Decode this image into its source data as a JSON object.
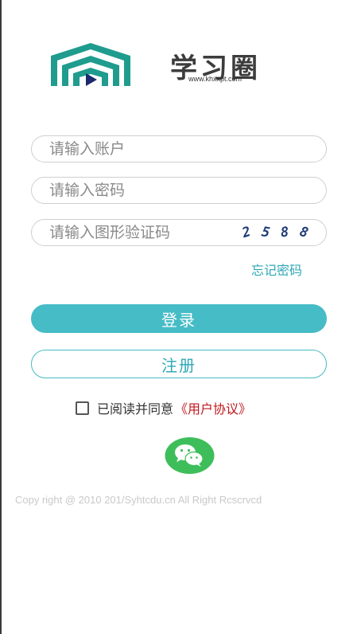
{
  "brand": {
    "title": "学习圈",
    "url": "www.khxxpt.com",
    "accent_color": "#45bcc6"
  },
  "form": {
    "account_placeholder": "请输入账户",
    "password_placeholder": "请输入密码",
    "captcha_placeholder": "请输入图形验证码",
    "captcha_digits": [
      "2",
      "5",
      "8",
      "8"
    ],
    "forgot_password": "忘记密码"
  },
  "buttons": {
    "login": "登录",
    "register": "注册"
  },
  "agreement": {
    "text": "已阅读并同意",
    "link": "《用户协议》",
    "checked": false
  },
  "social": {
    "icon": "wechat-icon",
    "color": "#3ebe5a"
  },
  "footer": {
    "copyright": "Copy right @ 2010 201/Syhtcdu.cn All Right Rcscrvcd"
  }
}
